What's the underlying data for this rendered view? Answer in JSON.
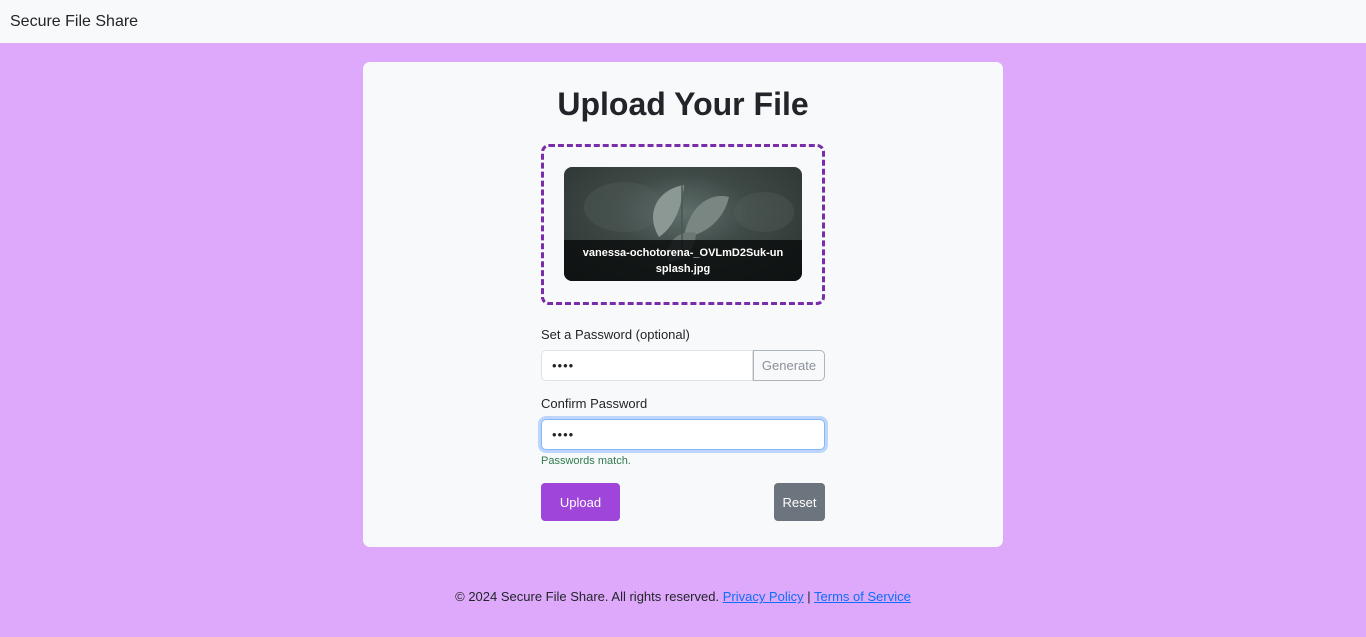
{
  "nav": {
    "brand": "Secure File Share"
  },
  "upload": {
    "title": "Upload Your File",
    "file_name": "vanessa-ochotorena-_OVLmD2Suk-unsplash.jpg"
  },
  "password": {
    "label": "Set a Password (optional)",
    "value": "••••",
    "generate_label": "Generate"
  },
  "confirm": {
    "label": "Confirm Password",
    "value": "••••",
    "status": "Passwords match."
  },
  "actions": {
    "upload_label": "Upload",
    "reset_label": "Reset"
  },
  "footer": {
    "copyright": "© 2024 Secure File Share. All rights reserved.",
    "privacy_link": "Privacy Policy",
    "separator": "|",
    "terms_link": "Terms of Service"
  },
  "colors": {
    "page_background": "#dfa9fb",
    "accent": "#9f45d9",
    "dropzone_border": "#7b2cab",
    "success_text": "#2f7a4f",
    "secondary_button": "#6c757d"
  }
}
